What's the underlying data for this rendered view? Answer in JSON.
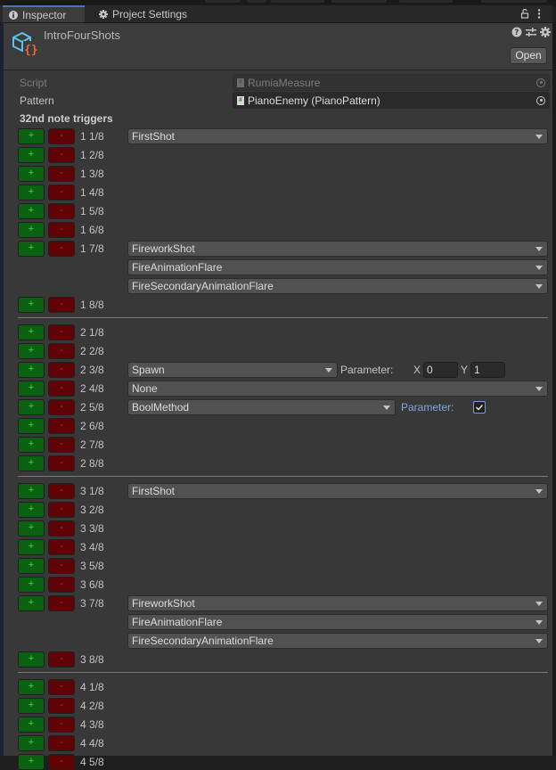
{
  "tabs": [
    {
      "label": "Inspector",
      "icon": "info-icon",
      "active": true
    },
    {
      "label": "Project Settings",
      "icon": "gear-icon",
      "active": false
    }
  ],
  "tab_actions": {
    "lock_icon": "lock-icon",
    "menu_icon": "kebab-menu-icon"
  },
  "header": {
    "title": "IntroFourShots",
    "icons": [
      "help-icon",
      "preset-icon",
      "settings-icon"
    ],
    "open_label": "Open"
  },
  "fields": {
    "script_label": "Script",
    "script_value": "RumiaMeasure",
    "pattern_label": "Pattern",
    "pattern_value": "PianoEnemy (PianoPattern)"
  },
  "section_title": "32nd note triggers",
  "button_labels": {
    "add": "+",
    "remove": "-"
  },
  "parameter_label": "Parameter:",
  "measures": [
    {
      "beats": [
        {
          "label": "1 1/8",
          "triggers": [
            {
              "method": "FirstShot"
            }
          ]
        },
        {
          "label": "1 2/8",
          "triggers": []
        },
        {
          "label": "1 3/8",
          "triggers": []
        },
        {
          "label": "1 4/8",
          "triggers": []
        },
        {
          "label": "1 5/8",
          "triggers": []
        },
        {
          "label": "1 6/8",
          "triggers": []
        },
        {
          "label": "1 7/8",
          "triggers": [
            {
              "method": "FireworkShot"
            },
            {
              "method": "FireAnimationFlare"
            },
            {
              "method": "FireSecondaryAnimationFlare"
            }
          ]
        },
        {
          "label": "1 8/8",
          "triggers": []
        }
      ]
    },
    {
      "beats": [
        {
          "label": "2 1/8",
          "triggers": []
        },
        {
          "label": "2 2/8",
          "triggers": []
        },
        {
          "label": "2 3/8",
          "triggers": [
            {
              "method": "Spawn",
              "param_type": "vector2",
              "x_label": "X",
              "x": "0",
              "y_label": "Y",
              "y": "1"
            }
          ]
        },
        {
          "label": "2 4/8",
          "triggers": [
            {
              "method": "None"
            }
          ]
        },
        {
          "label": "2 5/8",
          "triggers": [
            {
              "method": "BoolMethod",
              "param_type": "bool",
              "value": true
            }
          ]
        },
        {
          "label": "2 6/8",
          "triggers": []
        },
        {
          "label": "2 7/8",
          "triggers": []
        },
        {
          "label": "2 8/8",
          "triggers": []
        }
      ]
    },
    {
      "beats": [
        {
          "label": "3 1/8",
          "triggers": [
            {
              "method": "FirstShot"
            }
          ]
        },
        {
          "label": "3 2/8",
          "triggers": []
        },
        {
          "label": "3 3/8",
          "triggers": []
        },
        {
          "label": "3 4/8",
          "triggers": []
        },
        {
          "label": "3 5/8",
          "triggers": []
        },
        {
          "label": "3 6/8",
          "triggers": []
        },
        {
          "label": "3 7/8",
          "triggers": [
            {
              "method": "FireworkShot"
            },
            {
              "method": "FireAnimationFlare"
            },
            {
              "method": "FireSecondaryAnimationFlare"
            }
          ]
        },
        {
          "label": "3 8/8",
          "triggers": []
        }
      ]
    },
    {
      "beats": [
        {
          "label": "4 1/8",
          "triggers": []
        },
        {
          "label": "4 2/8",
          "triggers": []
        },
        {
          "label": "4 3/8",
          "triggers": []
        },
        {
          "label": "4 4/8",
          "triggers": []
        },
        {
          "label": "4 5/8",
          "triggers": []
        }
      ]
    }
  ]
}
